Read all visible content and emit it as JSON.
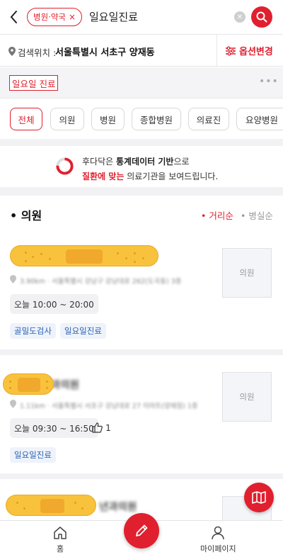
{
  "colors": {
    "accent": "#e0202e",
    "badge_text": "#2a5fb0",
    "badge_bg": "#eef3fb",
    "sticker": "#f9c23c"
  },
  "search": {
    "filter_chip": "병원·약국",
    "filter_chip_close": "×",
    "query": "일요일진료",
    "clear_icon": "clear-icon",
    "search_icon": "search-icon"
  },
  "location": {
    "prefix": "검색위치 :",
    "value": "서울특별시 서초구 양재동",
    "options_label": "옵션변경"
  },
  "active_tag": {
    "label": "일요일 진료",
    "more": "•••"
  },
  "categories": [
    {
      "label": "전체",
      "active": true
    },
    {
      "label": "의원",
      "active": false
    },
    {
      "label": "병원",
      "active": false
    },
    {
      "label": "종합병원",
      "active": false
    },
    {
      "label": "의료진",
      "active": false
    },
    {
      "label": "요양병원",
      "active": false
    }
  ],
  "info_banner": {
    "line1_pre": "후다닥은 ",
    "line1_bold": "통계데이터 기반",
    "line1_post": "으로",
    "line2_red": "질환에 맞는",
    "line2_post": " 의료기관을 보여드립니다."
  },
  "section": {
    "title": "• 의원",
    "sort_distance": "• 거리순",
    "sort_beds": "• 병실순"
  },
  "clinics": [
    {
      "name": "",
      "address": "3.90km · 서울특별시 강남구 강남대로 262(도곡동) 3층",
      "hours": "오늘 10:00 ~ 20:00",
      "likes": "",
      "badges": [
        "골밀도검사",
        "일요일진료"
      ],
      "thumbnail": "의원"
    },
    {
      "name": "과의원",
      "address": "1.11km · 서울특별시 서초구 강남대로 27 이마트(양재점) 1층",
      "hours": "오늘 09:30 ~ 16:50",
      "likes": "1",
      "badges": [
        "일요일진료"
      ],
      "thumbnail": "의원"
    },
    {
      "name": "년과의원",
      "address": "",
      "hours": "",
      "likes": "",
      "badges": [],
      "thumbnail": ""
    }
  ],
  "bottom_nav": {
    "home": "홈",
    "mypage": "마이페이지"
  }
}
